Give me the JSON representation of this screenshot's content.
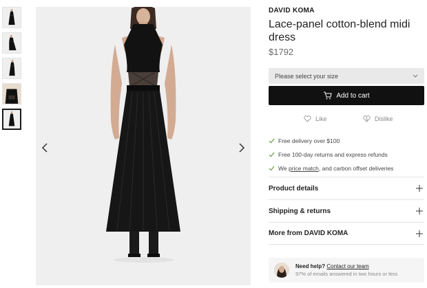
{
  "product": {
    "brand": "DAVID KOMA",
    "title": "Lace-panel cotton-blend midi dress",
    "price": "$1792"
  },
  "gallery": {
    "thumbnail_count": 5,
    "active_index": 4,
    "prev_icon": "chevron-left-icon",
    "next_icon": "chevron-right-icon"
  },
  "size_select": {
    "placeholder": "Please select your size"
  },
  "cart": {
    "add_label": "Add to cart"
  },
  "reactions": {
    "like_label": "Like",
    "dislike_label": "Dislike"
  },
  "perks": [
    {
      "text": "Free delivery over $100"
    },
    {
      "text": "Free 100-day returns and express refunds"
    },
    {
      "prefix": "We ",
      "link": "price match",
      "suffix": ", and carbon offset deliveries"
    }
  ],
  "accordions": {
    "details": "Product details",
    "shipping": "Shipping & returns",
    "more": "More from DAVID KOMA"
  },
  "help": {
    "question": "Need help?",
    "link": "Contact our team",
    "subtext": "97% of emails answered in two hours or less"
  },
  "colors": {
    "button_bg": "#111111",
    "select_bg": "#e9e9e9",
    "image_bg": "#efefef",
    "check": "#6a9a3a"
  }
}
